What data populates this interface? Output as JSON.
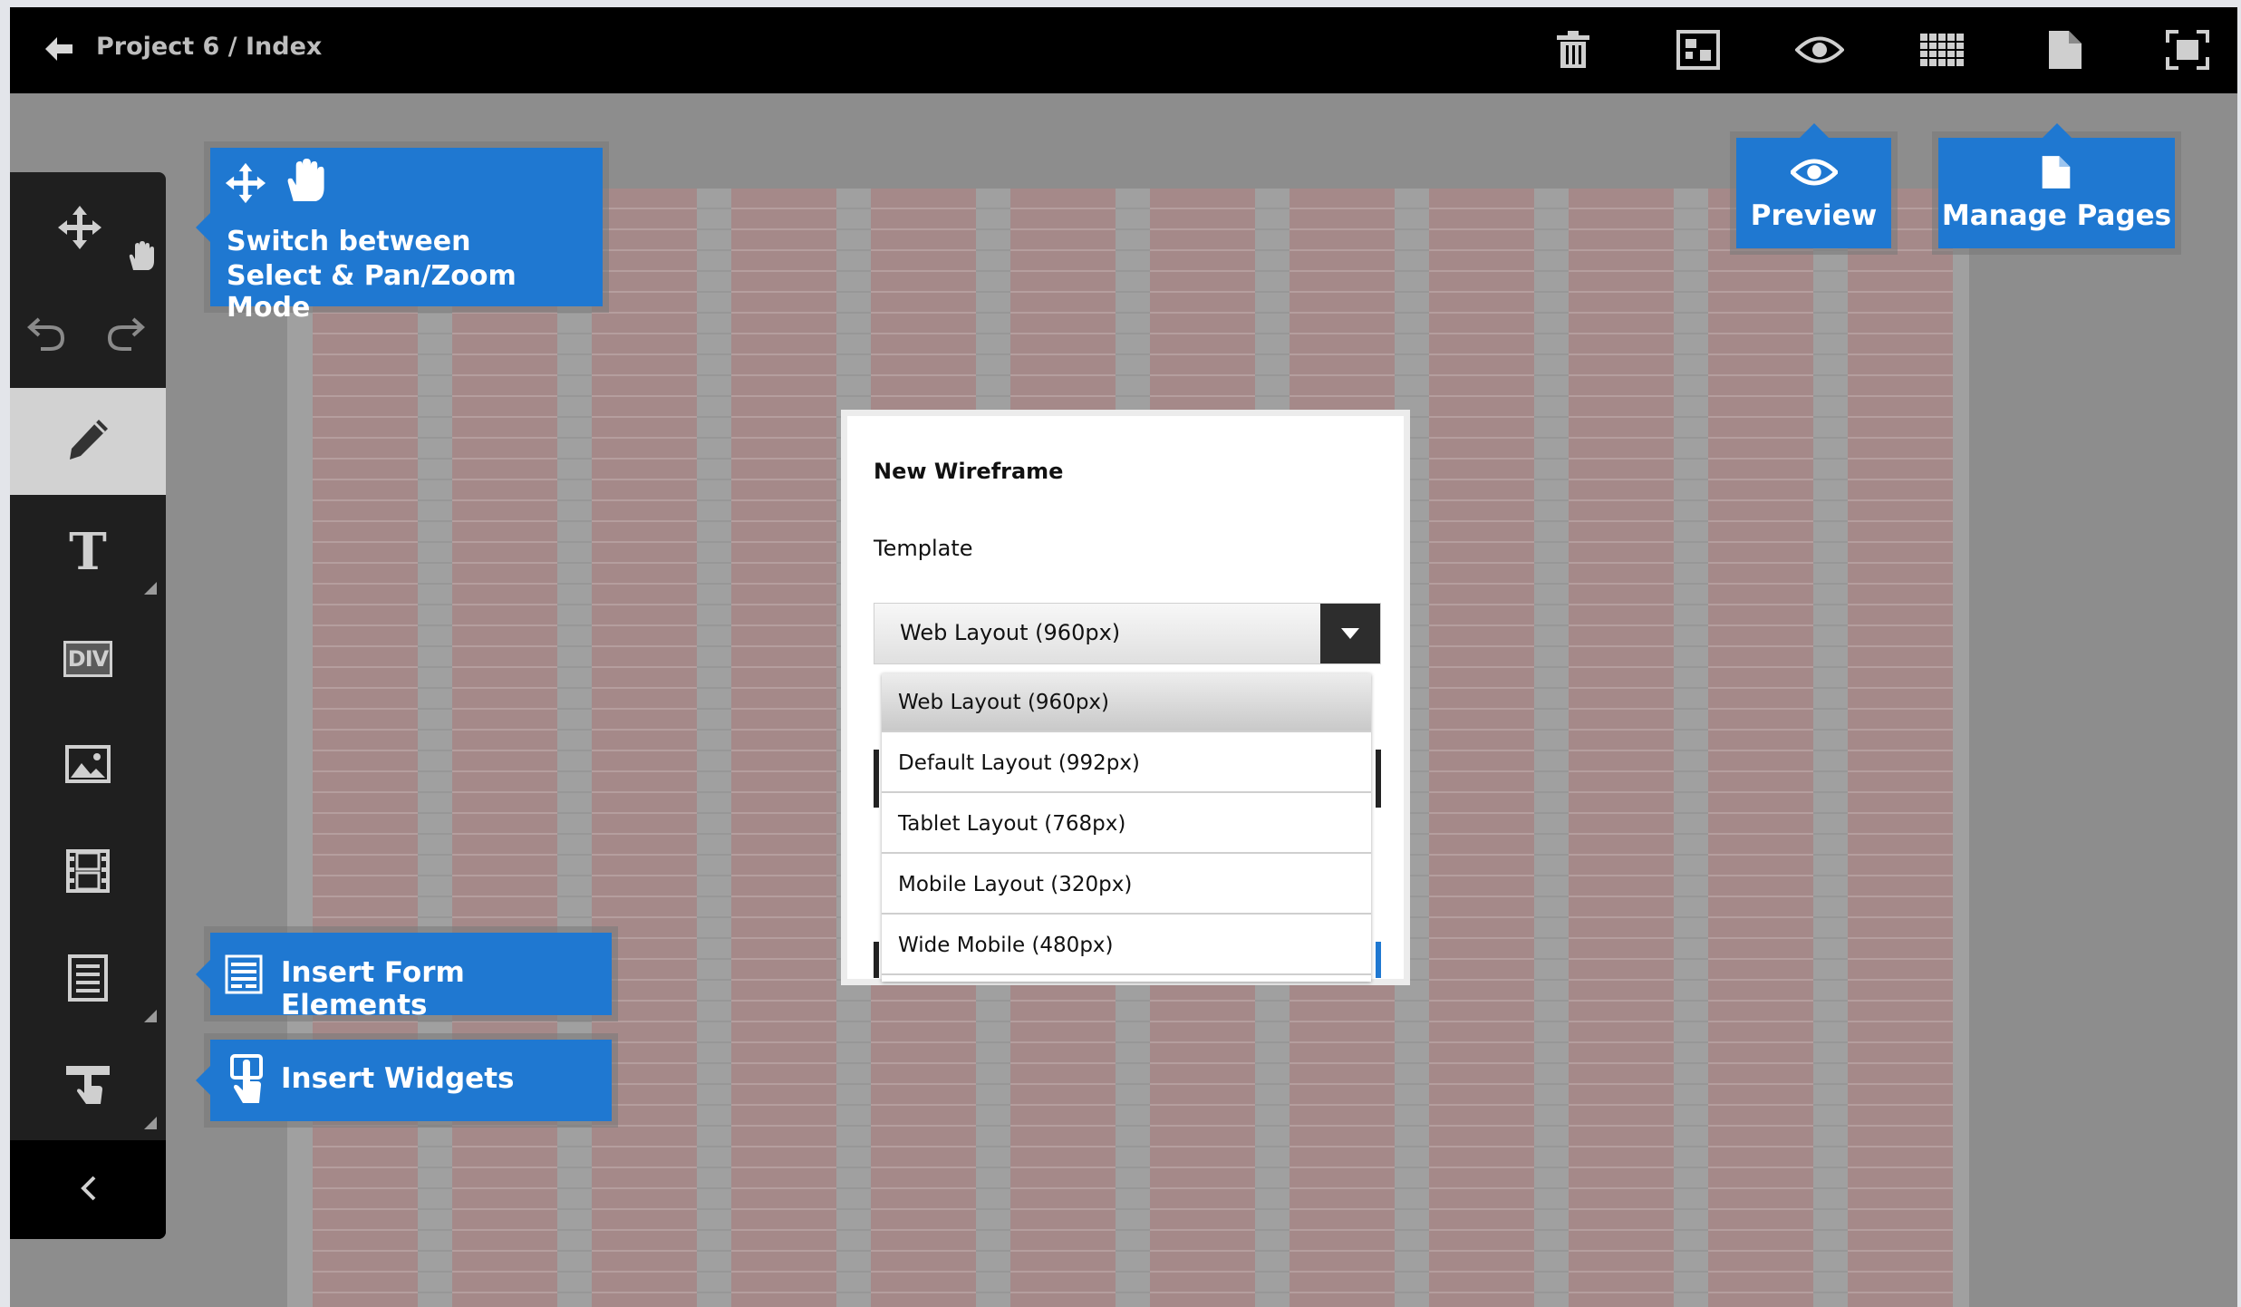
{
  "topbar": {
    "breadcrumb": "Project 6 / Index",
    "icons": [
      "back-arrow-icon",
      "trash-icon",
      "layout-icon",
      "eye-icon",
      "grid-icon",
      "page-icon",
      "fullscreen-icon"
    ]
  },
  "left_toolbar": {
    "icons": [
      "move-icon",
      "hand-icon",
      "undo-icon",
      "redo-icon",
      "pencil-icon",
      "text-icon",
      "div-icon",
      "image-icon",
      "video-icon",
      "form-icon",
      "widget-icon",
      "collapse-chevron-icon"
    ],
    "div_label": "DIV",
    "text_glyph": "T"
  },
  "callouts": {
    "switch_mode_line1": "Switch between",
    "switch_mode_line2": "Select & Pan/Zoom Mode",
    "insert_form": "Insert Form Elements",
    "insert_widgets": "Insert Widgets",
    "preview": "Preview",
    "manage_pages": "Manage Pages"
  },
  "dialog": {
    "title": "New Wireframe",
    "template_label": "Template",
    "selected_value": "Web Layout (960px)",
    "options": [
      "Web Layout (960px)",
      "Default Layout (992px)",
      "Tablet Layout (768px)",
      "Mobile Layout (320px)",
      "Wide Mobile (480px)"
    ]
  },
  "colors": {
    "callout_blue": "#1f78d1",
    "toolbar_dark": "#1f1f1f",
    "column_tint": "#a58989"
  }
}
